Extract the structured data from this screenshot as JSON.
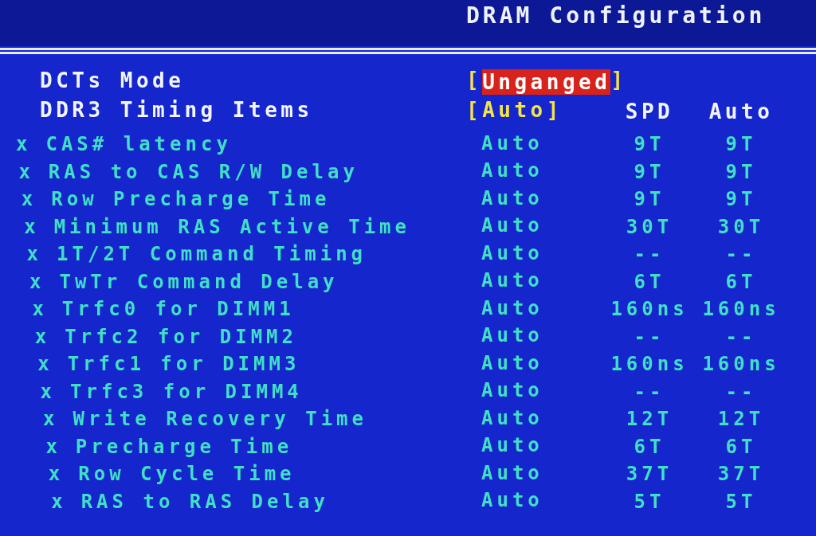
{
  "header": {
    "title": "DRAM Configuration"
  },
  "settings": [
    {
      "label": "DCTs Mode",
      "open": "[",
      "value": "Unganged",
      "close": "]",
      "selected": true
    },
    {
      "label": "DDR3 Timing Items",
      "open": "[",
      "value": "Auto",
      "close": "]",
      "selected": false,
      "column_headers": [
        "SPD",
        "Auto"
      ]
    }
  ],
  "rows": [
    {
      "marker": "x",
      "label": "CAS# latency",
      "disabled": true,
      "value": "Auto",
      "spd": "9T",
      "auto": "9T"
    },
    {
      "marker": "x",
      "label": "RAS to CAS R/W Delay",
      "disabled": true,
      "value": "Auto",
      "spd": "9T",
      "auto": "9T"
    },
    {
      "marker": "x",
      "label": "Row Precharge Time",
      "disabled": true,
      "value": "Auto",
      "spd": "9T",
      "auto": "9T"
    },
    {
      "marker": "x",
      "label": "Minimum RAS Active Time",
      "disabled": true,
      "value": "Auto",
      "spd": "30T",
      "auto": "30T"
    },
    {
      "marker": "x",
      "label": "1T/2T Command Timing",
      "disabled": true,
      "value": "Auto",
      "spd": "--",
      "auto": "--"
    },
    {
      "marker": "x",
      "label": "TwTr Command Delay",
      "disabled": true,
      "value": "Auto",
      "spd": "6T",
      "auto": "6T"
    },
    {
      "marker": "x",
      "label": "Trfc0 for DIMM1",
      "disabled": true,
      "value": "Auto",
      "spd": "160ns",
      "auto": "160ns"
    },
    {
      "marker": "x",
      "label": "Trfc2 for DIMM2",
      "disabled": true,
      "value": "Auto",
      "spd": "--",
      "auto": "--"
    },
    {
      "marker": "x",
      "label": "Trfc1 for DIMM3",
      "disabled": true,
      "value": "Auto",
      "spd": "160ns",
      "auto": "160ns"
    },
    {
      "marker": "x",
      "label": "Trfc3 for DIMM4",
      "disabled": true,
      "value": "Auto",
      "spd": "--",
      "auto": "--"
    },
    {
      "marker": "x",
      "label": "Write Recovery Time",
      "disabled": true,
      "value": "Auto",
      "spd": "12T",
      "auto": "12T"
    },
    {
      "marker": "x",
      "label": "Precharge Time",
      "disabled": true,
      "value": "Auto",
      "spd": "6T",
      "auto": "6T"
    },
    {
      "marker": "x",
      "label": "Row Cycle Time",
      "disabled": true,
      "value": "Auto",
      "spd": "37T",
      "auto": "37T"
    },
    {
      "marker": "x",
      "label": "RAS to RAS Delay",
      "disabled": true,
      "value": "Auto",
      "spd": "5T",
      "auto": "5T"
    }
  ]
}
